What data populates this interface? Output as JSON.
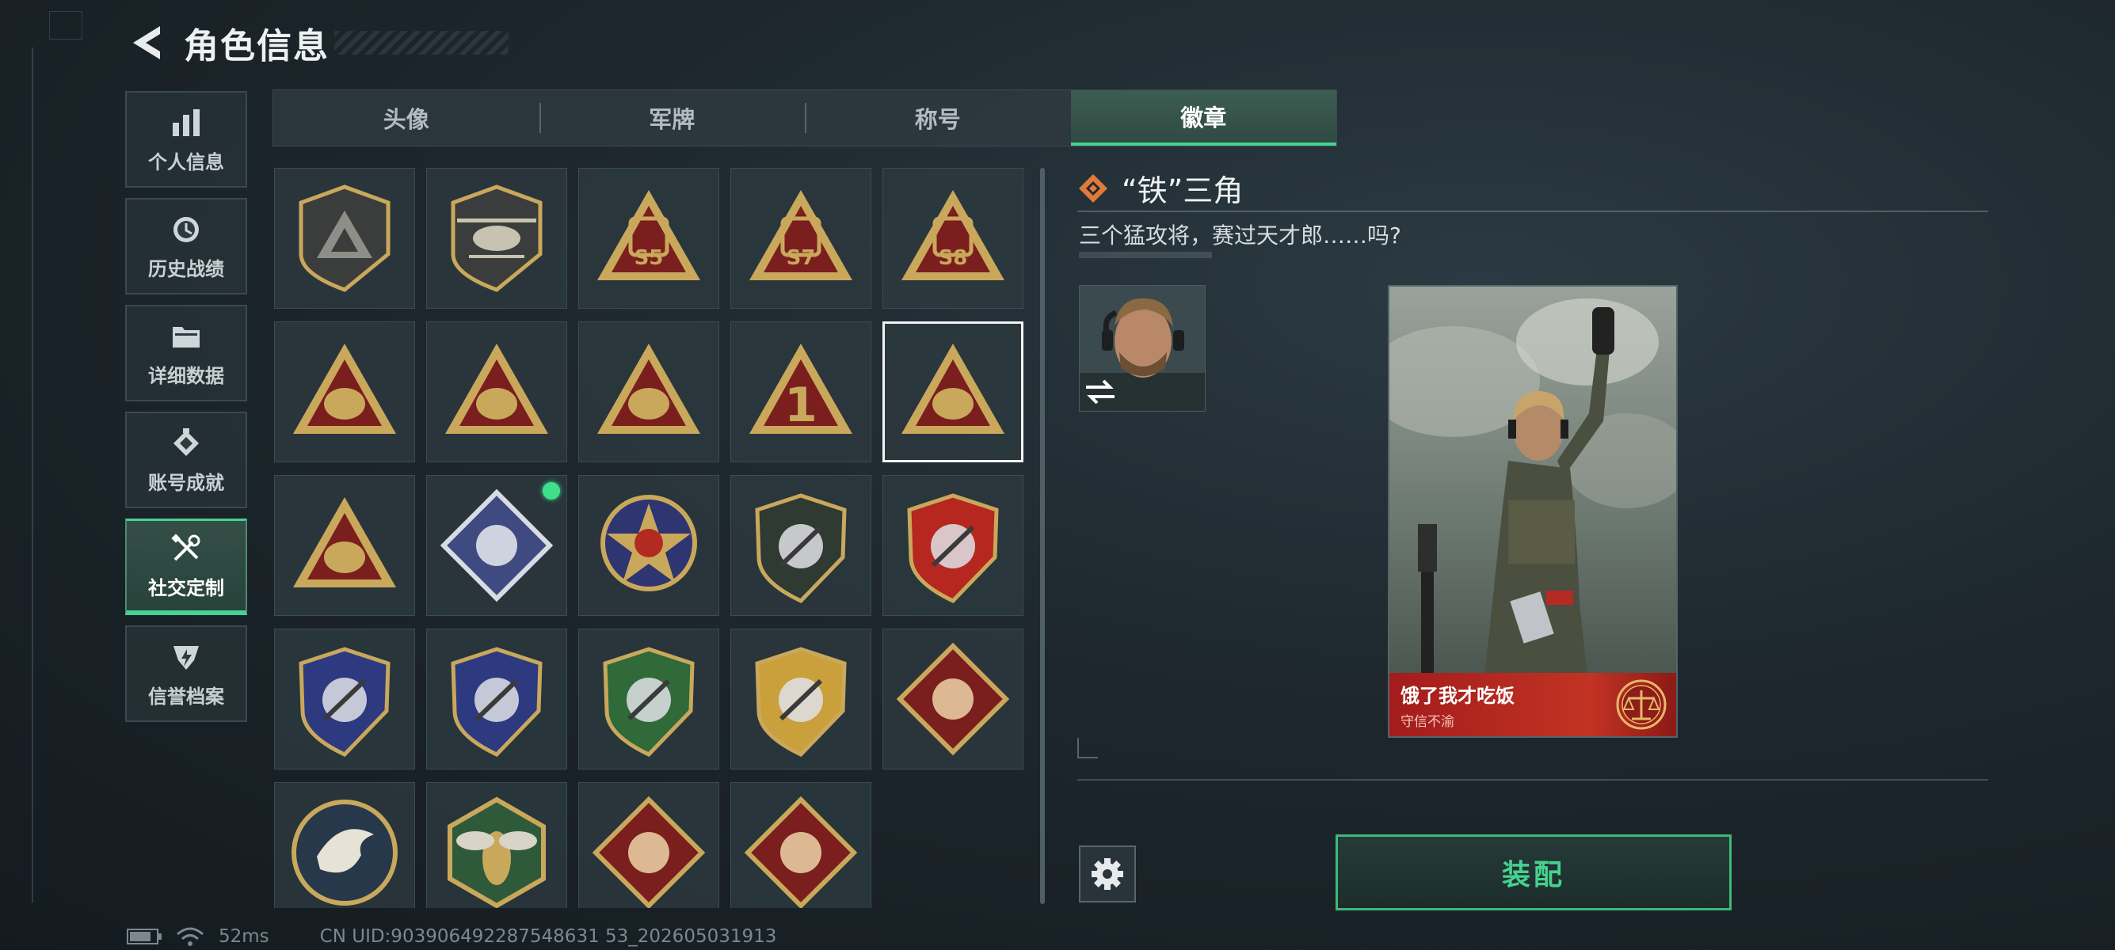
{
  "header": {
    "title": "角色信息"
  },
  "sidebar": {
    "items": [
      {
        "label": "个人信息",
        "icon": "bar-chart-icon",
        "active": false
      },
      {
        "label": "历史战绩",
        "icon": "clock-history-icon",
        "active": false
      },
      {
        "label": "详细数据",
        "icon": "folder-icon",
        "active": false
      },
      {
        "label": "账号成就",
        "icon": "achievement-icon",
        "active": false
      },
      {
        "label": "社交定制",
        "icon": "tools-icon",
        "active": true
      },
      {
        "label": "信誉档案",
        "icon": "reputation-shield-icon",
        "active": false
      }
    ]
  },
  "tabs": [
    {
      "label": "头像",
      "active": false
    },
    {
      "label": "军牌",
      "active": false
    },
    {
      "label": "称号",
      "active": false
    },
    {
      "label": "徽章",
      "active": true
    }
  ],
  "badges": [
    {
      "icon": "tri-shield-gray-badge"
    },
    {
      "icon": "helicopter-shield-badge"
    },
    {
      "icon": "s5-season-badge",
      "text": "S5"
    },
    {
      "icon": "s7-season-badge",
      "text": "S7"
    },
    {
      "icon": "s8-season-badge",
      "text": "S8"
    },
    {
      "icon": "operator-face-triangle-badge"
    },
    {
      "icon": "crossed-guns-triangle-badge"
    },
    {
      "icon": "helmet-triangle-badge"
    },
    {
      "icon": "number-one-triangle-badge",
      "text": "1"
    },
    {
      "icon": "iron-triangle-badge",
      "selected": true
    },
    {
      "icon": "rocket-triangle-badge"
    },
    {
      "icon": "rose-diamond-badge",
      "new": true
    },
    {
      "icon": "star-compass-badge"
    },
    {
      "icon": "dark-crest-shield-badge"
    },
    {
      "icon": "winged-crest-shield-badge"
    },
    {
      "icon": "blue-gem-shield-badge"
    },
    {
      "icon": "blue-rifle-shield-badge"
    },
    {
      "icon": "green-rifle-shield-badge"
    },
    {
      "icon": "gold-sword-shield-badge"
    },
    {
      "icon": "wolf-diamond-badge"
    },
    {
      "icon": "eagle-round-badge"
    },
    {
      "icon": "wasp-hex-badge"
    },
    {
      "icon": "dragon-diamond-badge"
    },
    {
      "icon": "runner-diamond-badge"
    }
  ],
  "detail": {
    "badge_name": "“铁”三角",
    "badge_desc": "三个猛攻将，赛过天才郎……吗?",
    "card_name": "饿了我才吃饭",
    "card_subtitle": "守信不渝"
  },
  "actions": {
    "equip_label": "装配"
  },
  "status": {
    "ping": "52ms",
    "uid": "CN UID:903906492287548631 53_202605031913"
  },
  "colors": {
    "accent": "#46d290",
    "badge_red": "#7a1e1e",
    "badge_gold": "#c9a85c"
  }
}
